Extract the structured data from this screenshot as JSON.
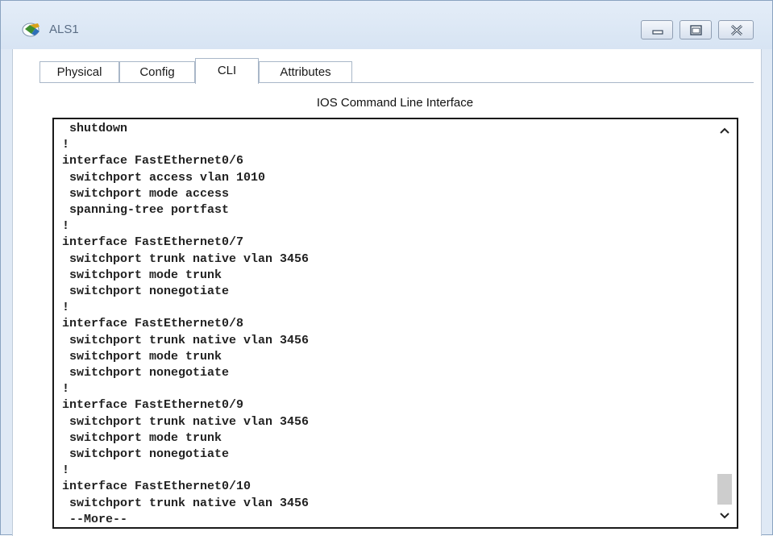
{
  "window": {
    "title": "ALS1",
    "icon": "packet-tracer-switch-icon",
    "controls": [
      "minimize",
      "maximize",
      "close"
    ]
  },
  "tabs": [
    {
      "label": "Physical",
      "active": false
    },
    {
      "label": "Config",
      "active": false
    },
    {
      "label": "CLI",
      "active": true
    },
    {
      "label": "Attributes",
      "active": false
    }
  ],
  "cli": {
    "heading": "IOS Command Line Interface",
    "lines": [
      " shutdown",
      "!",
      "interface FastEthernet0/6",
      " switchport access vlan 1010",
      " switchport mode access",
      " spanning-tree portfast",
      "!",
      "interface FastEthernet0/7",
      " switchport trunk native vlan 3456",
      " switchport mode trunk",
      " switchport nonegotiate",
      "!",
      "interface FastEthernet0/8",
      " switchport trunk native vlan 3456",
      " switchport mode trunk",
      " switchport nonegotiate",
      "!",
      "interface FastEthernet0/9",
      " switchport trunk native vlan 3456",
      " switchport mode trunk",
      " switchport nonegotiate",
      "!",
      "interface FastEthernet0/10",
      " switchport trunk native vlan 3456",
      " --More--"
    ]
  },
  "colors": {
    "frame": "#dfe9f5",
    "console_border": "#1a1a1a",
    "text": "#222222"
  }
}
